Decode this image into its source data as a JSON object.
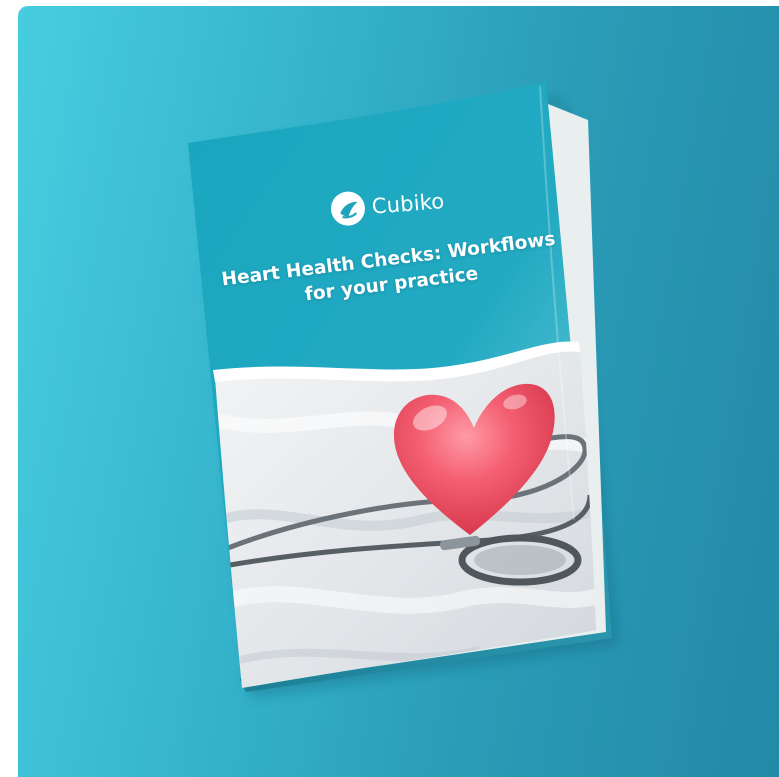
{
  "brochure": {
    "brand_name": "Cubiko",
    "title_line1": "Heart Health Checks: Workflows",
    "title_line2": "for your practice",
    "logo_icon": "cubiko-logo-icon"
  },
  "colors": {
    "background_light": "#47cde0",
    "background_dark": "#2389a8",
    "cover_teal": "#1fa3bd",
    "heart_pink": "#f0566b"
  }
}
